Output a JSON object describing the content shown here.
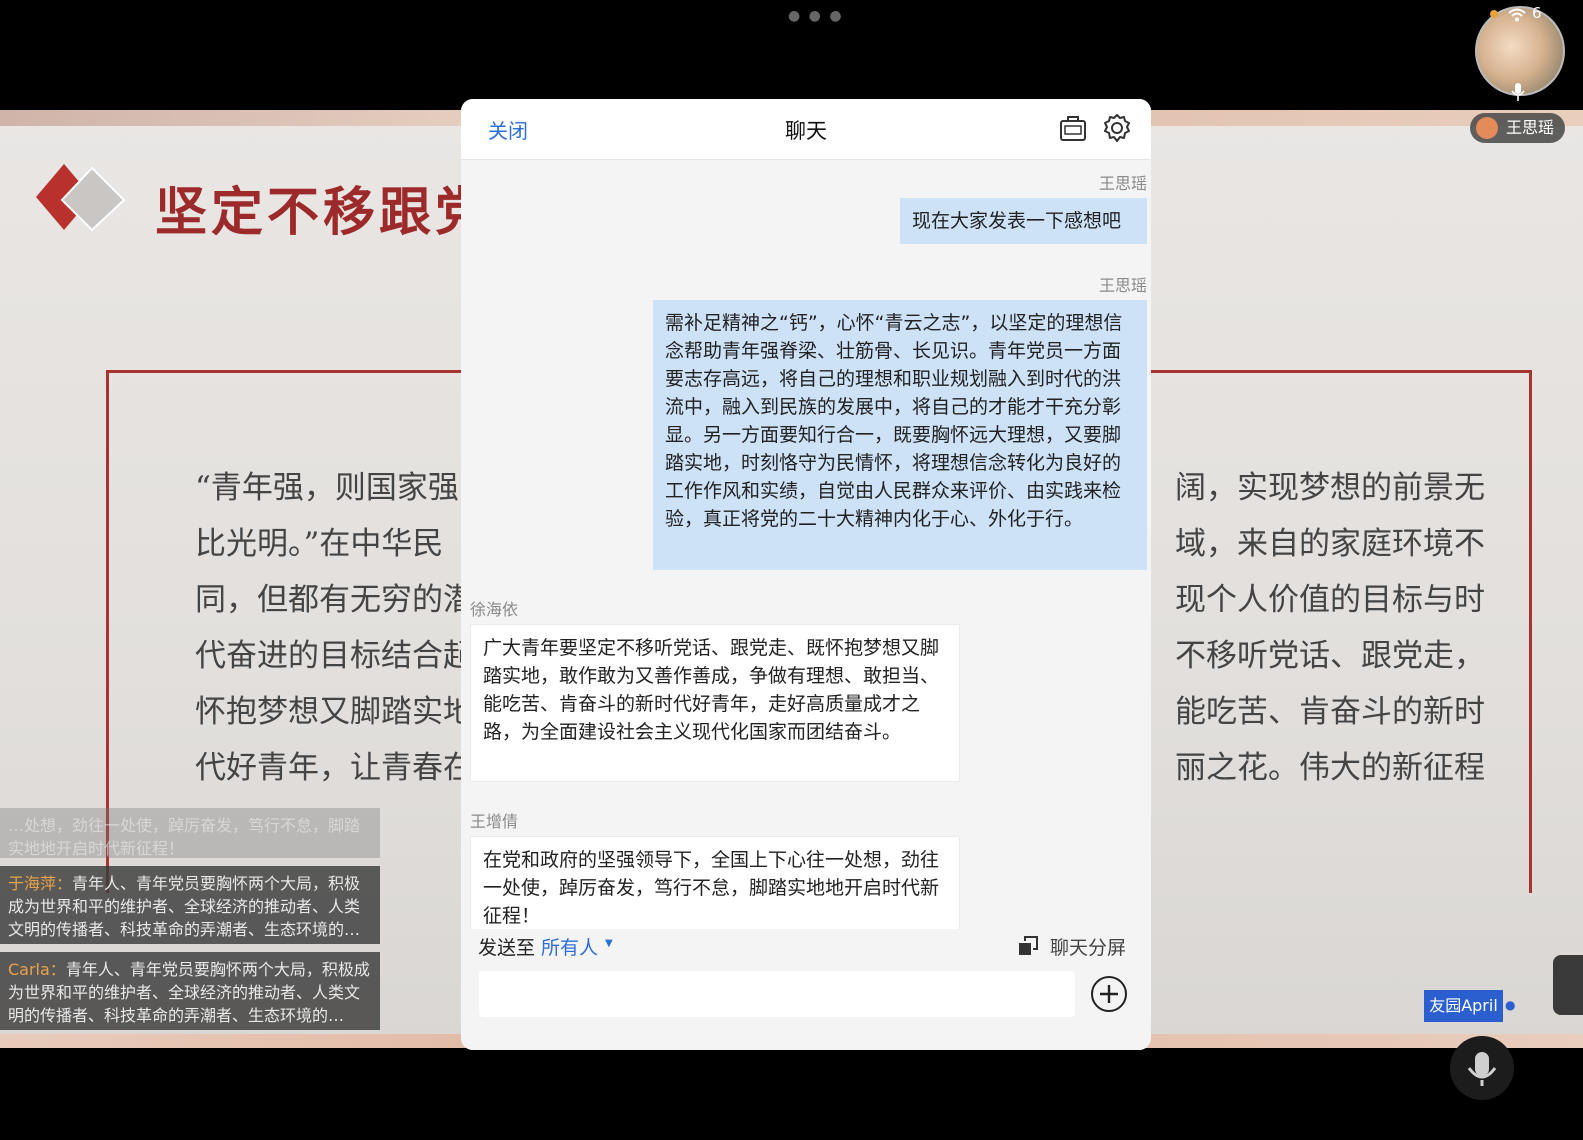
{
  "slide": {
    "title": "坚定不移跟党",
    "lines": [
      {
        "left": "“青年强，则国家强",
        "right": "阔，实现梦想的前景无"
      },
      {
        "left": "比光明。”在中华民",
        "right": "域，来自的家庭环境不"
      },
      {
        "left": "同，但都有无穷的潜",
        "right": "现个人价值的目标与时"
      },
      {
        "left": "代奋进的目标结合起",
        "right": "不移听党话、跟党走，"
      },
      {
        "left": "怀抱梦想又脚踏实地",
        "right": "能吃苦、肯奋斗的新时"
      },
      {
        "left": "代好青年，让青春在",
        "right": "丽之花。伟大的新征程"
      }
    ]
  },
  "danmaku": [
    {
      "who": "",
      "text": "…处想，劲往一处使，踔厉奋发，笃行不怠，脚踏实地地开启时代新征程！"
    },
    {
      "who": "于海萍：",
      "text": "青年人、青年党员要胸怀两个大局，积极成为世界和平的维护者、全球经济的推动者、人类文明的传播者、科技革命的弄潮者、生态环境的…"
    },
    {
      "who": "Carla：",
      "text": "青年人、青年党员要胸怀两个大局，积极成为世界和平的维护者、全球经济的推动者、人类文明的传播者、科技革命的弄潮者、生态环境的…"
    }
  ],
  "status": {
    "battery": "6"
  },
  "presenter": {
    "name": "王思瑶"
  },
  "friend_tag": "友园April",
  "chat": {
    "close": "关闭",
    "title": "聊天",
    "messages": [
      {
        "sender": "王思瑶",
        "text": "现在大家发表一下感想吧",
        "mine": true
      },
      {
        "sender": "王思瑶",
        "text": "需补足精神之“钙”，心怀“青云之志”，以坚定的理想信念帮助青年强脊梁、壮筋骨、长见识。青年党员一方面要志存高远，将自己的理想和职业规划融入到时代的洪流中，融入到民族的发展中，将自己的才能才干充分彰显。另一方面要知行合一，既要胸怀远大理想，又要脚踏实地，时刻恪守为民情怀，将理想信念转化为良好的工作作风和实绩，自觉由人民群众来评价、由实践来检验，真正将党的二十大精神内化于心、外化于行。",
        "mine": true
      },
      {
        "sender": "徐海依",
        "text": "广大青年要坚定不移听党话、跟党走、既怀抱梦想又脚踏实地，敢作敢为又善作善成，争做有理想、敢担当、能吃苦、肯奋斗的新时代好青年，走好高质量成才之路，为全面建设社会主义现代化国家而团结奋斗。",
        "mine": false
      },
      {
        "sender": "王增倩",
        "text": "在党和政府的坚强领导下，全国上下心往一处想，劲往一处使，踔厉奋发，笃行不怠，脚踏实地地开启时代新征程！",
        "mine": false
      }
    ],
    "send_to_label": "发送至",
    "send_target": "所有人",
    "split_label": "聊天分屏",
    "input_value": ""
  },
  "icons": {
    "notice": "announcement-icon",
    "settings": "gear-icon",
    "plus": "plus-circle-icon",
    "split": "split-screen-icon",
    "mic": "microphone-icon"
  },
  "colors": {
    "accent": "#2d6fd8",
    "my_bubble": "#cde1f7",
    "slide_title": "#9d2a2a"
  }
}
